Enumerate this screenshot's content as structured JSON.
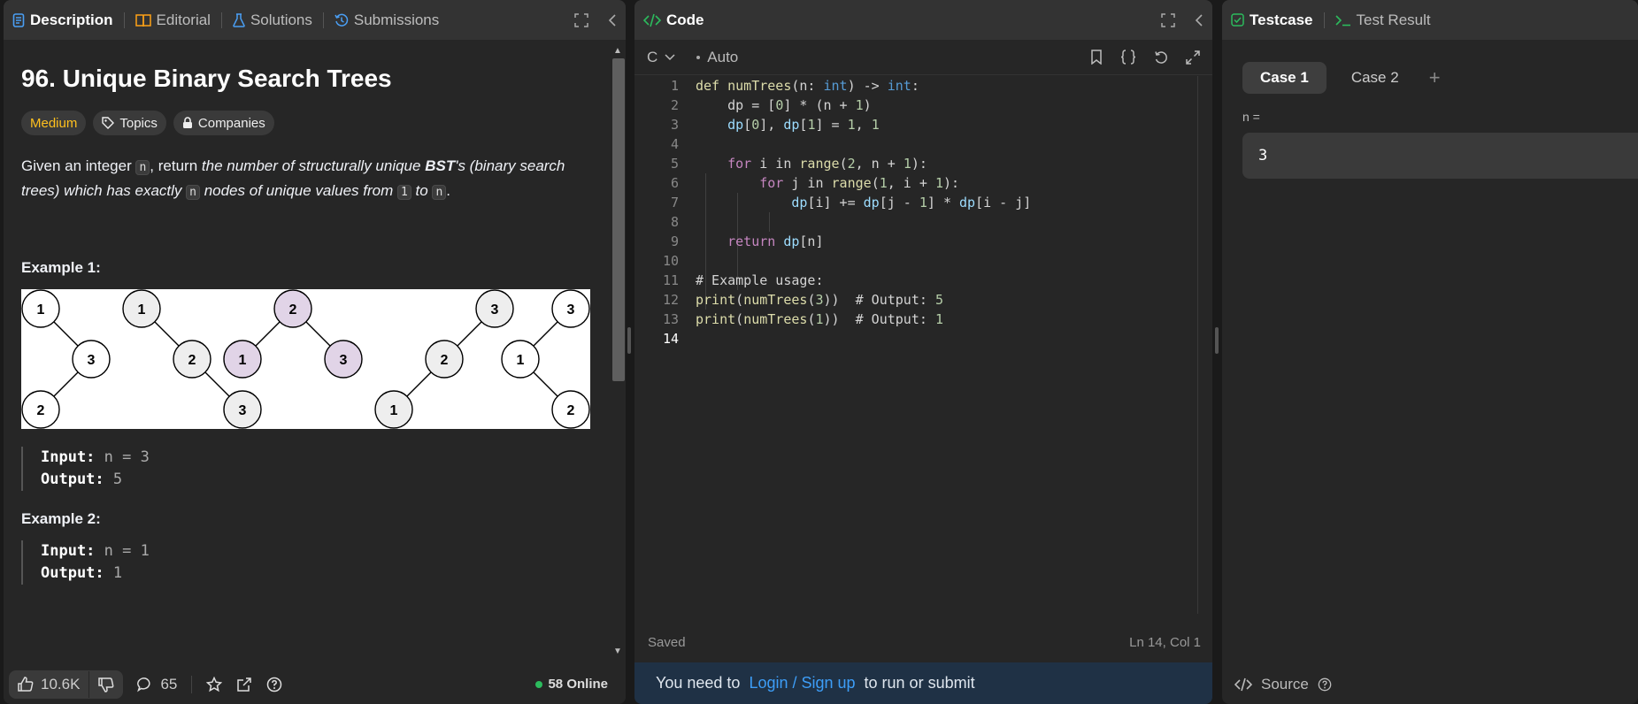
{
  "left": {
    "tabs": [
      {
        "label": "Description",
        "icon": "document-icon",
        "color": "#4a9ff5"
      },
      {
        "label": "Editorial",
        "icon": "book-icon",
        "color": "#ffa116"
      },
      {
        "label": "Solutions",
        "icon": "flask-icon",
        "color": "#4a9ff5"
      },
      {
        "label": "Submissions",
        "icon": "history-icon",
        "color": "#4a9ff5"
      }
    ],
    "title": "96. Unique Binary Search Trees",
    "badges": {
      "difficulty": "Medium",
      "topics": "Topics",
      "companies": "Companies"
    },
    "desc": {
      "p1": "Given an integer ",
      "n1": "n",
      "p2": ", return ",
      "em1": "the number of structurally unique ",
      "bst": "BST",
      "em2": "'s (binary search trees) which has exactly ",
      "n2": "n",
      "em3": " nodes of unique values from ",
      "one": "1",
      "em4": " to ",
      "n3": "n",
      "p3": "."
    },
    "example1": {
      "title": "Example 1:",
      "input_label": "Input:",
      "input": " n = 3",
      "output_label": "Output:",
      "output": " 5"
    },
    "example2": {
      "title": "Example 2:",
      "input_label": "Input:",
      "input": " n = 1",
      "output_label": "Output:",
      "output": " 1"
    },
    "trees": {
      "labels": [
        "1",
        "3",
        "2",
        "1",
        "2",
        "3",
        "2",
        "1",
        "3",
        "3",
        "2",
        "1",
        "3",
        "1",
        "2"
      ]
    },
    "footer": {
      "likes": "10.6K",
      "comments": "65",
      "online": "58 Online"
    }
  },
  "mid": {
    "header": "Code",
    "language": "C",
    "auto": "Auto",
    "code_lines": [
      "def numTrees(n: int) -> int:",
      "    dp = [0] * (n + 1)",
      "    dp[0], dp[1] = 1, 1",
      "",
      "    for i in range(2, n + 1):",
      "        for j in range(1, i + 1):",
      "            dp[i] += dp[j - 1] * dp[i - j]",
      "",
      "    return dp[n]",
      "",
      "# Example usage:",
      "print(numTrees(3))  # Output: 5",
      "print(numTrees(1))  # Output: 1",
      ""
    ],
    "status_left": "Saved",
    "status_right": "Ln 14, Col 1",
    "login": {
      "prefix": "You need to",
      "link": "Login / Sign up",
      "suffix": "to run or submit"
    }
  },
  "right": {
    "tabs": [
      {
        "label": "Testcase",
        "icon": "checkbox-icon",
        "color": "#2cbb5d"
      },
      {
        "label": "Test Result",
        "icon": "terminal-icon",
        "color": "#2cbb5d"
      }
    ],
    "cases": [
      "Case 1",
      "Case 2"
    ],
    "field_label": "n =",
    "field_value": "3",
    "footer": {
      "source": "Source"
    }
  }
}
